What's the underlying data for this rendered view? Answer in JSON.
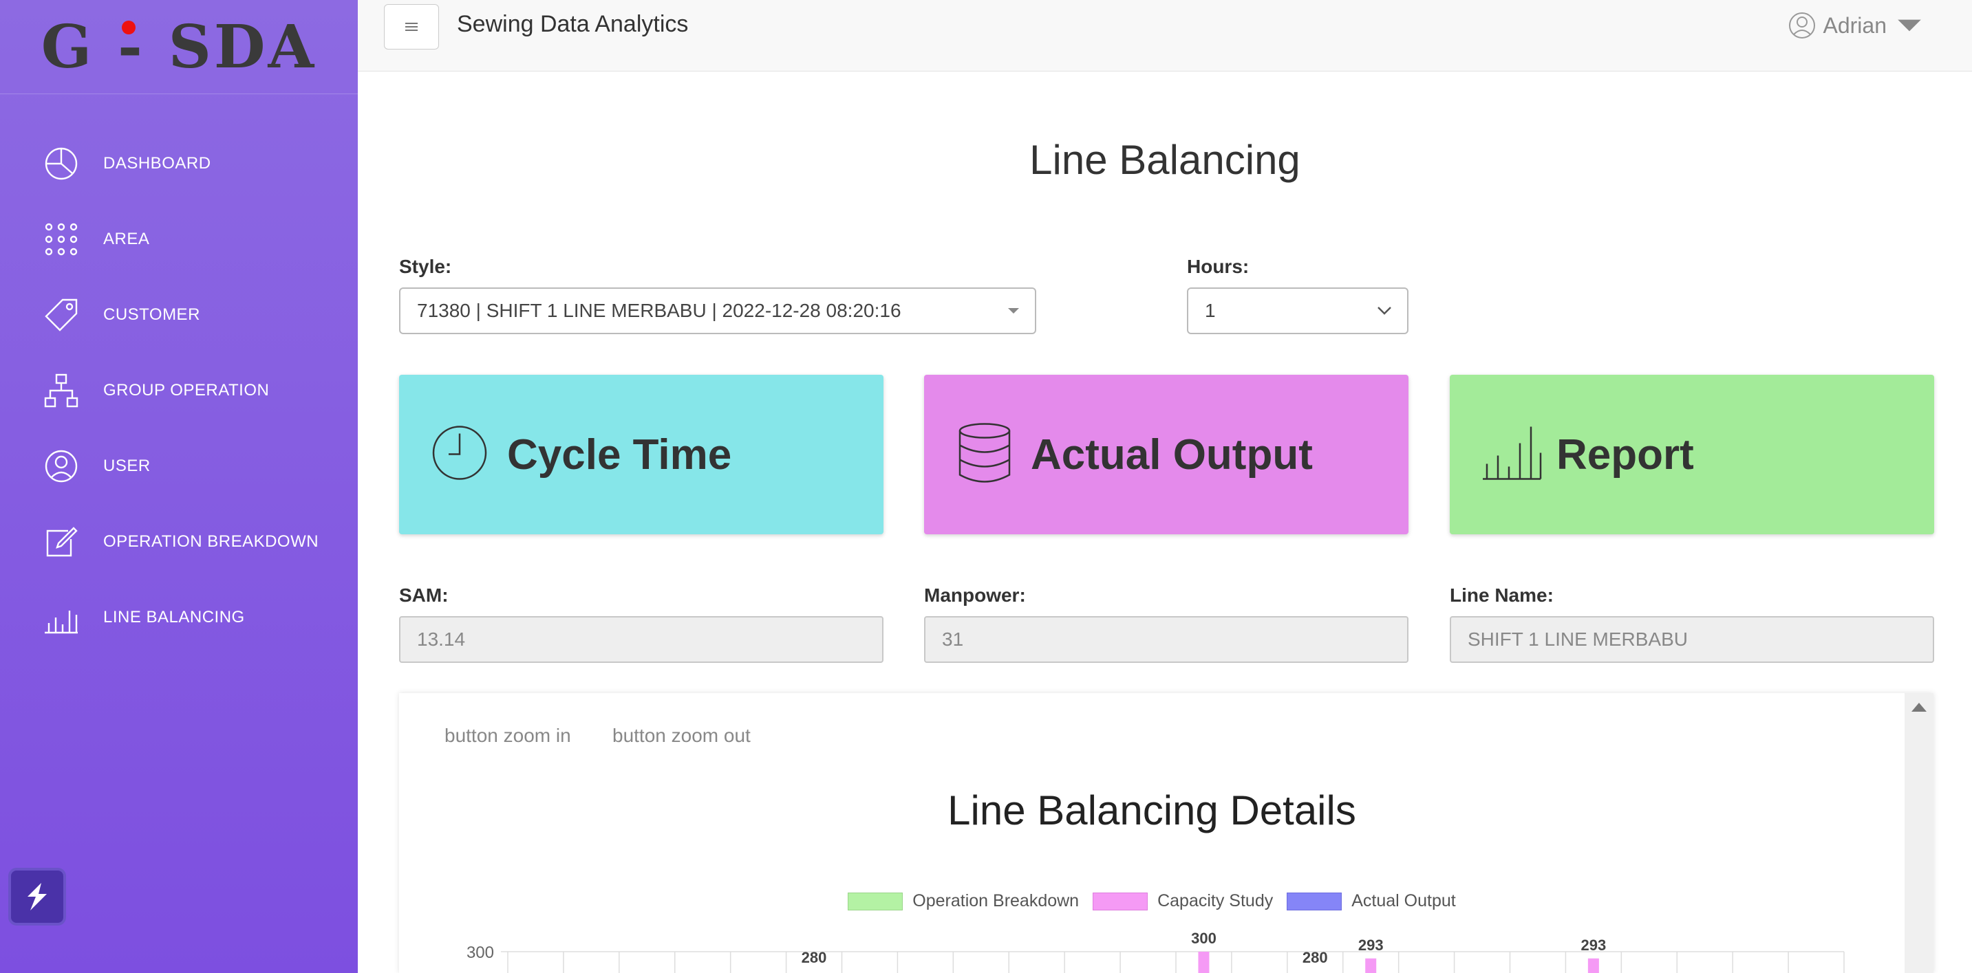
{
  "brand": {
    "text": "G - SDA"
  },
  "sidebar": {
    "items": [
      {
        "label": "DASHBOARD",
        "icon": "pie-chart-icon"
      },
      {
        "label": "AREA",
        "icon": "grid-dots-icon"
      },
      {
        "label": "CUSTOMER",
        "icon": "tag-icon"
      },
      {
        "label": "GROUP OPERATION",
        "icon": "hierarchy-icon"
      },
      {
        "label": "USER",
        "icon": "user-circle-icon"
      },
      {
        "label": "OPERATION BREAKDOWN",
        "icon": "edit-note-icon"
      },
      {
        "label": "LINE BALANCING",
        "icon": "bar-chart-icon"
      }
    ]
  },
  "header": {
    "app_title": "Sewing Data Analytics",
    "user": "Adrian"
  },
  "page": {
    "title": "Line Balancing"
  },
  "filters": {
    "style_label": "Style:",
    "style_value": "71380 | SHIFT 1 LINE MERBABU | 2022-12-28 08:20:16",
    "hours_label": "Hours:",
    "hours_value": "1"
  },
  "cards": [
    {
      "label": "Cycle Time",
      "color": "#86e6e9",
      "icon": "clock-icon"
    },
    {
      "label": "Actual Output",
      "color": "#e48aeb",
      "icon": "database-icon"
    },
    {
      "label": "Report",
      "color": "#a3eb99",
      "icon": "bar-chart-icon"
    }
  ],
  "info": {
    "sam_label": "SAM:",
    "sam_value": "13.14",
    "manpower_label": "Manpower:",
    "manpower_value": "31",
    "line_label": "Line Name:",
    "line_value": "SHIFT 1 LINE MERBABU"
  },
  "chart_panel": {
    "zoom_in": "button zoom in",
    "zoom_out": "button zoom out"
  },
  "chart_data": {
    "type": "bar",
    "title": "Line Balancing Details",
    "legend": [
      {
        "name": "Operation Breakdown",
        "color": "#b4f2a4"
      },
      {
        "name": "Capacity Study",
        "color": "#f59af5"
      },
      {
        "name": "Actual Output",
        "color": "#8585f7"
      }
    ],
    "y_tick_visible": "300",
    "category_count": 24,
    "visible_labels": [
      {
        "category": 5,
        "value": "280"
      },
      {
        "category": 12,
        "value": "300"
      },
      {
        "category": 14,
        "value": "280"
      },
      {
        "category": 15,
        "value": "293"
      },
      {
        "category": 19,
        "value": "293"
      }
    ],
    "visible_bars": [
      {
        "category": 12,
        "series": "Capacity Study",
        "value": 300
      },
      {
        "category": 15,
        "series": "Capacity Study",
        "value": 293
      },
      {
        "category": 19,
        "series": "Capacity Study",
        "value": 293
      }
    ]
  }
}
